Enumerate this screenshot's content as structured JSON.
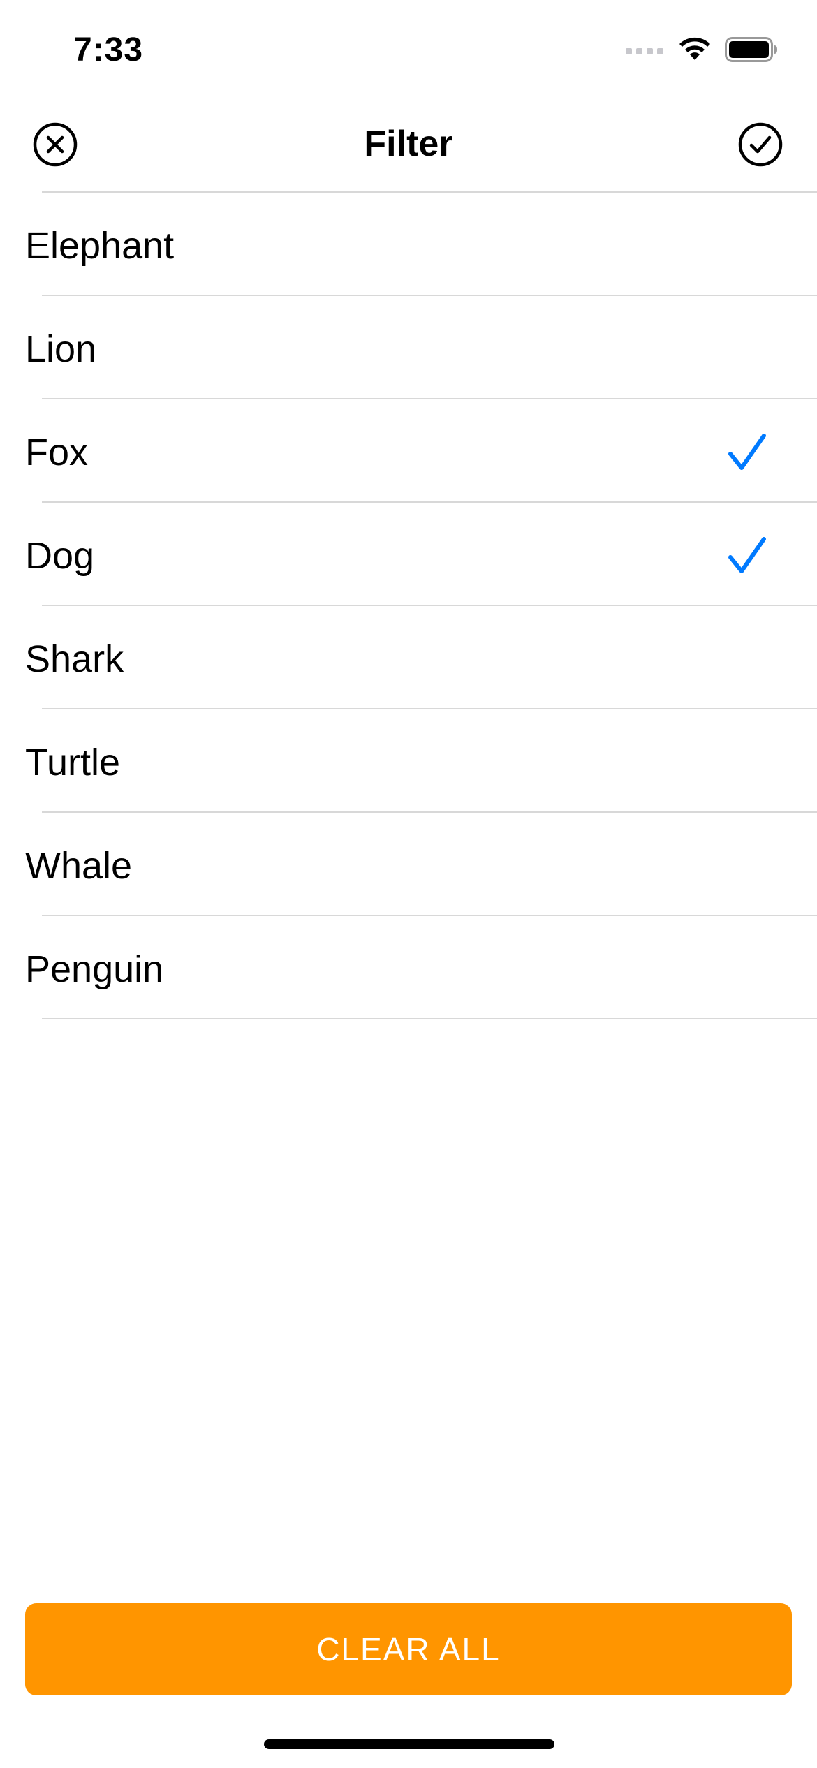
{
  "status_bar": {
    "time": "7:33",
    "icons": [
      "signal-icon",
      "wifi-icon",
      "battery-icon"
    ]
  },
  "nav": {
    "title": "Filter",
    "left_icon": "close-circle-icon",
    "right_icon": "checkmark-circle-icon"
  },
  "list": {
    "items": [
      {
        "label": "Elephant",
        "selected": false
      },
      {
        "label": "Lion",
        "selected": false
      },
      {
        "label": "Fox",
        "selected": true
      },
      {
        "label": "Dog",
        "selected": true
      },
      {
        "label": "Shark",
        "selected": false
      },
      {
        "label": "Turtle",
        "selected": false
      },
      {
        "label": "Whale",
        "selected": false
      },
      {
        "label": "Penguin",
        "selected": false
      }
    ]
  },
  "footer": {
    "clear_label": "CLEAR ALL"
  },
  "colors": {
    "accent": "#007AFF",
    "clear_button": "#FF9500",
    "separator": "#D8D8D8"
  }
}
